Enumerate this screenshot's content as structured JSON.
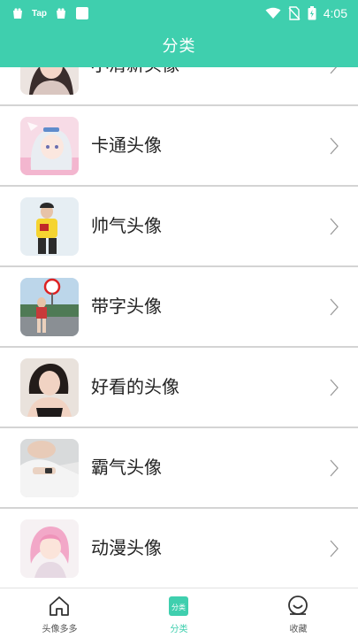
{
  "status_bar": {
    "left_text": "Tap",
    "time": "4:05",
    "icons": [
      "notification-app-icon",
      "notification-app-icon",
      "notification-square-icon",
      "wifi-icon",
      "no-sim-icon",
      "battery-icon"
    ]
  },
  "header": {
    "title": "分类"
  },
  "categories": [
    {
      "label": "小清新头像",
      "thumb": "portrait-photo"
    },
    {
      "label": "卡通头像",
      "thumb": "anime-illustration"
    },
    {
      "label": "帅气头像",
      "thumb": "portrait-photo"
    },
    {
      "label": "带字头像",
      "thumb": "street-photo"
    },
    {
      "label": "好看的头像",
      "thumb": "portrait-photo"
    },
    {
      "label": "霸气头像",
      "thumb": "portrait-photo"
    },
    {
      "label": "动漫头像",
      "thumb": "anime-illustration"
    }
  ],
  "tabbar": {
    "tabs": [
      {
        "label": "头像多多",
        "icon": "home-icon",
        "active": false
      },
      {
        "label": "分类",
        "icon": "category-icon",
        "icon_text": "分类",
        "active": true
      },
      {
        "label": "收藏",
        "icon": "favorite-icon",
        "active": false
      }
    ]
  },
  "colors": {
    "accent": "#3fcfae",
    "divider": "#d4d4d4",
    "text": "#222222"
  }
}
